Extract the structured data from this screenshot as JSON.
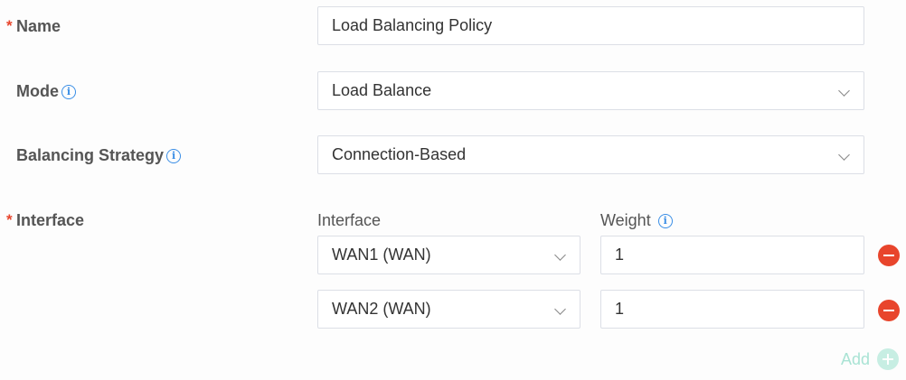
{
  "form": {
    "required_mark": "*",
    "info_glyph": "i",
    "name": {
      "label": "Name",
      "value": "Load Balancing Policy",
      "required": true
    },
    "mode": {
      "label": "Mode",
      "value": "Load Balance",
      "info_icon": "info-icon"
    },
    "strategy": {
      "label": "Balancing Strategy",
      "value": "Connection-Based",
      "info_icon": "info-icon"
    },
    "interface": {
      "label": "Interface",
      "required": true,
      "col_interface": "Interface",
      "col_weight": "Weight",
      "rows": [
        {
          "interface": "WAN1 (WAN)",
          "weight": "1"
        },
        {
          "interface": "WAN2 (WAN)",
          "weight": "1"
        }
      ],
      "add_label": "Add"
    }
  },
  "colors": {
    "required": "#e8452c",
    "info": "#3a8ee6",
    "remove": "#e8452c",
    "add": "#a9e3d4"
  }
}
